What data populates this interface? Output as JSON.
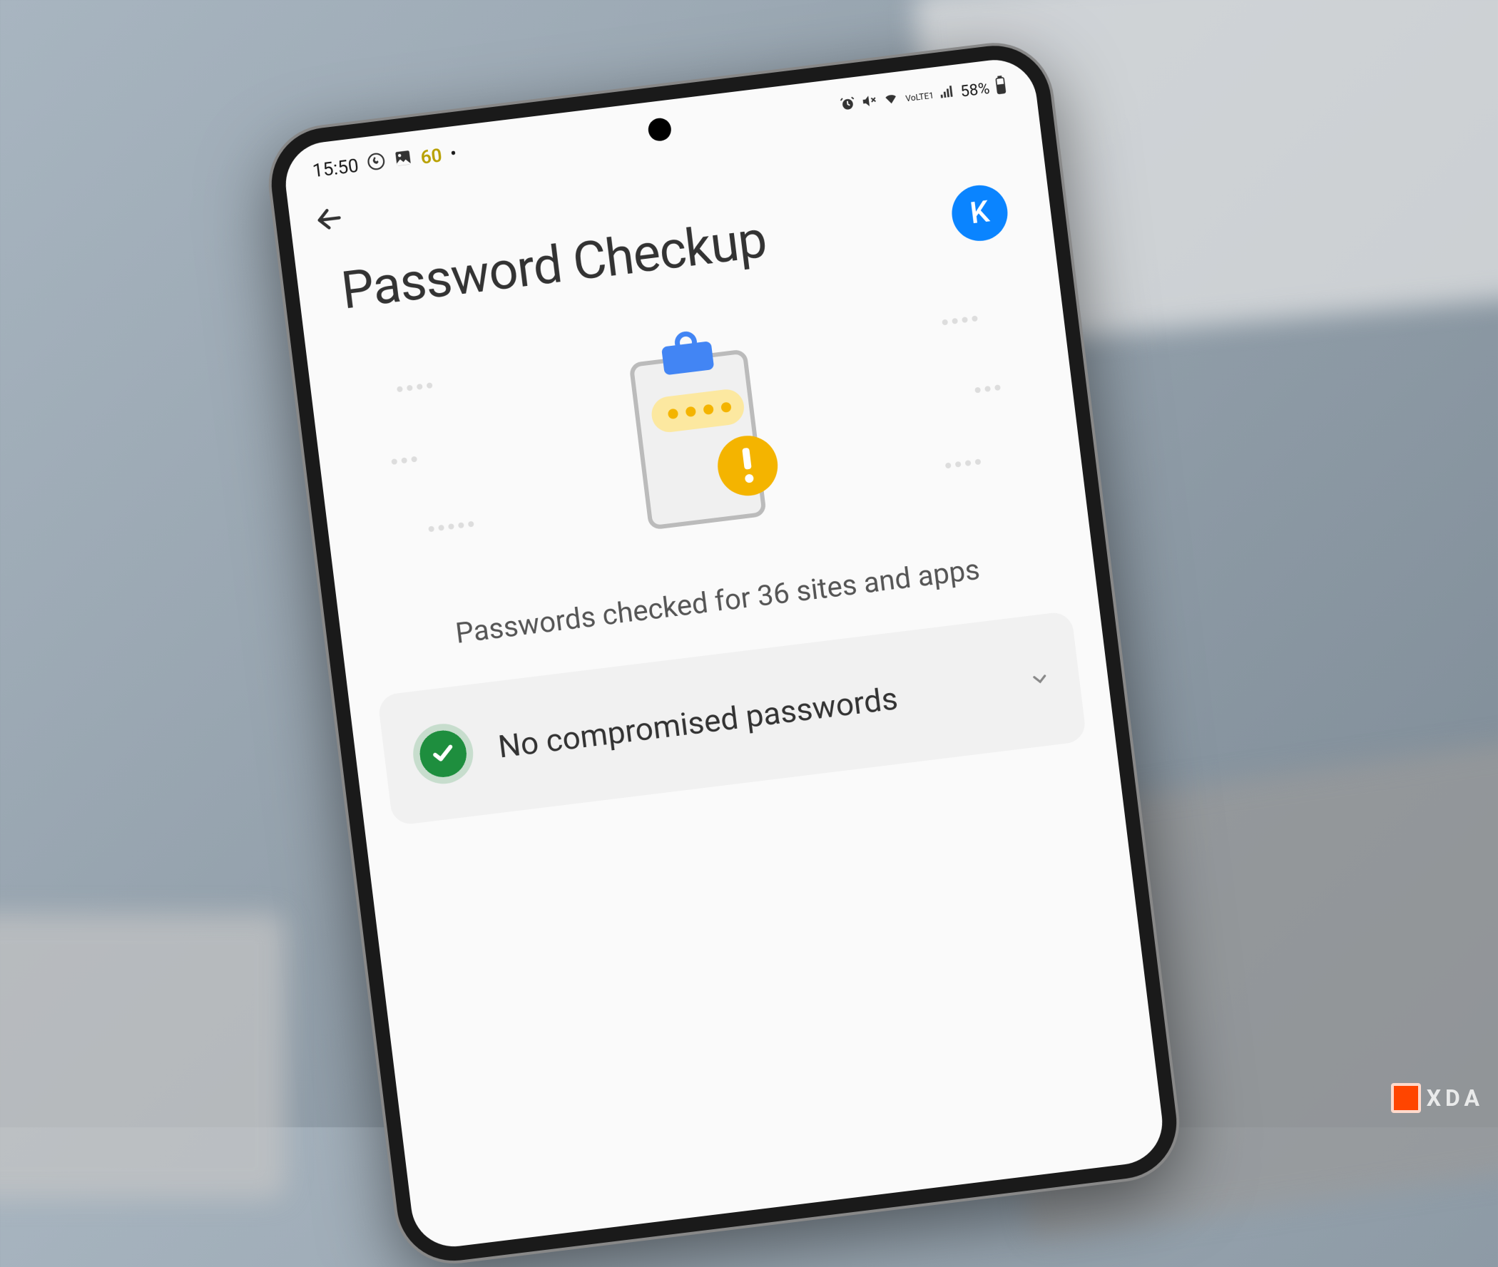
{
  "statusBar": {
    "time": "15:50",
    "fps": "60",
    "battery": "58%",
    "volte": "VoLTE1"
  },
  "header": {
    "title": "Password Checkup",
    "avatar": "K"
  },
  "subtitle": "Passwords checked for 36 sites and apps",
  "result": {
    "label": "No compromised passwords"
  },
  "watermark": "XDA",
  "colors": {
    "avatarBg": "#0a84ff",
    "success": "#1e8e3e",
    "warning": "#f4b400"
  }
}
